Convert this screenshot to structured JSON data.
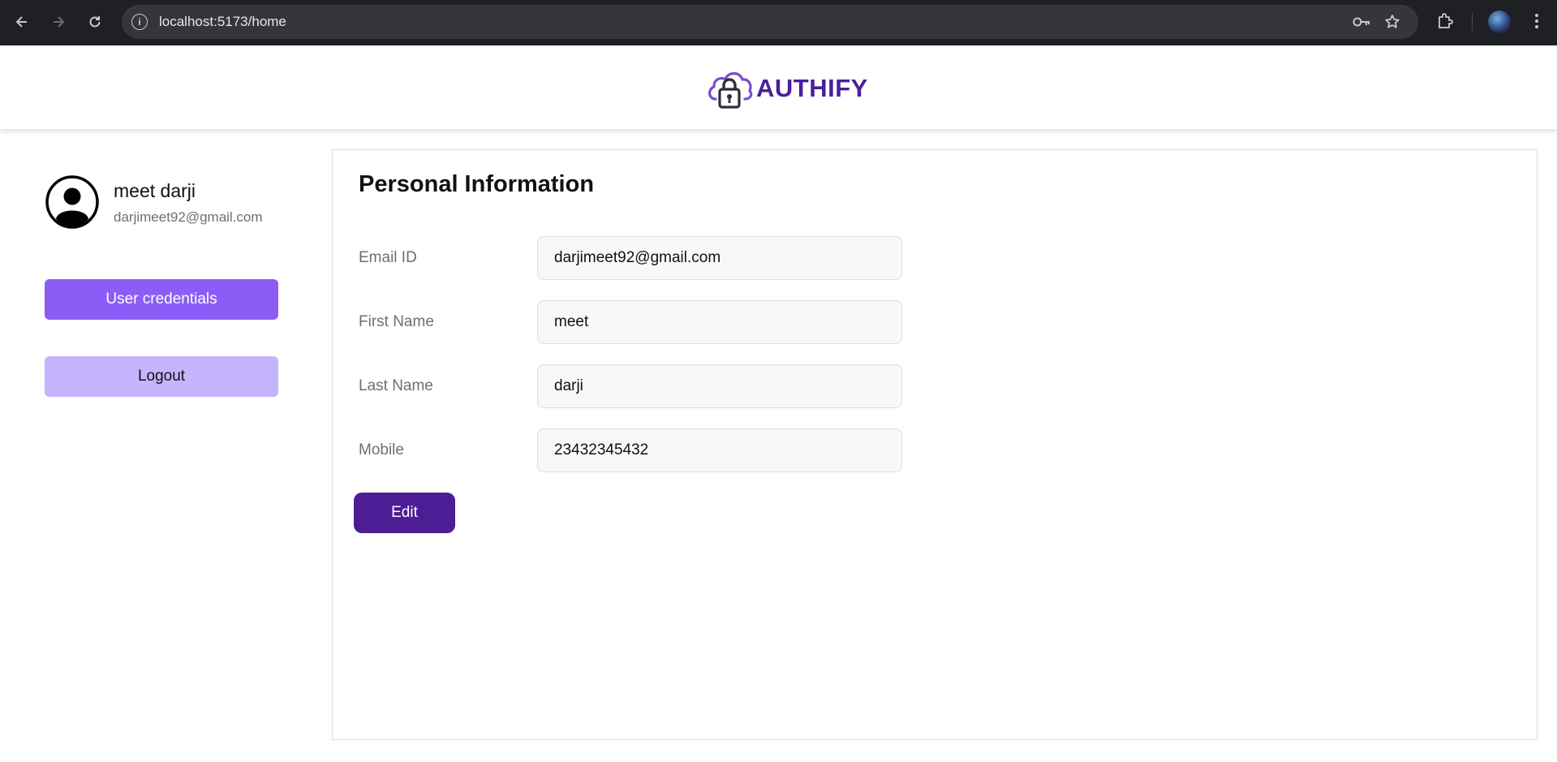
{
  "browser": {
    "url": "localhost:5173/home",
    "icons": [
      "back-icon",
      "forward-icon",
      "reload-icon",
      "site-info-icon",
      "password-key-icon",
      "bookmark-star-icon",
      "extensions-icon",
      "profile-avatar",
      "menu-dots-icon"
    ]
  },
  "header": {
    "brand_name": "AUTHIFY",
    "logo_icon": "cloud-lock-icon",
    "brand_color": "#4b1f9a"
  },
  "sidebar": {
    "user_name": "meet darji",
    "user_email": "darjimeet92@gmail.com",
    "avatar_icon": "user-avatar-icon",
    "credentials_label": "User credentials",
    "logout_label": "Logout",
    "colors": {
      "primary": "#8b5cf6",
      "secondary": "#c4b5fd"
    }
  },
  "main": {
    "title": "Personal Information",
    "fields": [
      {
        "label": "Email ID",
        "value": "darjimeet92@gmail.com"
      },
      {
        "label": "First Name",
        "value": "meet"
      },
      {
        "label": "Last Name",
        "value": "darji"
      },
      {
        "label": "Mobile",
        "value": "23432345432"
      }
    ],
    "edit_label": "Edit",
    "edit_color": "#4c1d95"
  }
}
